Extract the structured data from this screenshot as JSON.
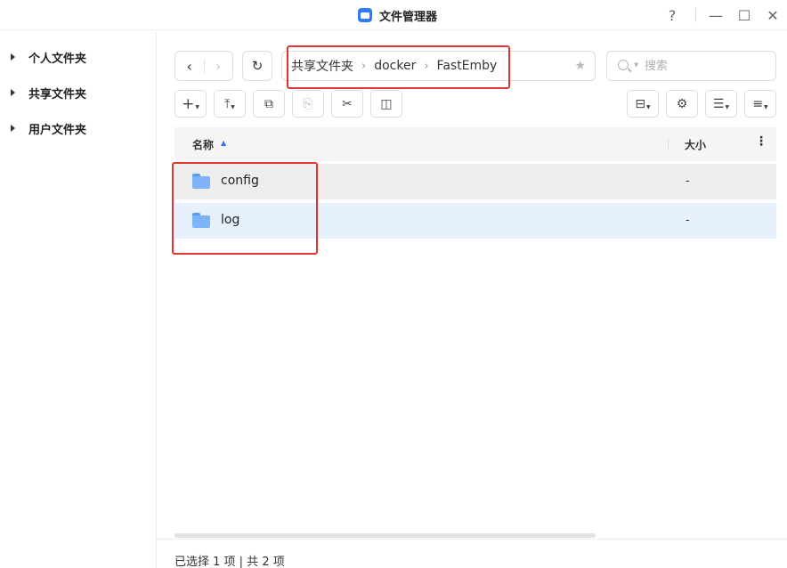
{
  "window": {
    "title": "文件管理器",
    "controls": {
      "help": "?",
      "minimize": "—",
      "maximize": "☐",
      "close": "✕"
    }
  },
  "sidebar": {
    "items": [
      {
        "label": "个人文件夹"
      },
      {
        "label": "共享文件夹"
      },
      {
        "label": "用户文件夹"
      }
    ]
  },
  "nav": {
    "back": "‹",
    "forward": "›",
    "refresh": "↻"
  },
  "breadcrumb": {
    "items": [
      "共享文件夹",
      "docker",
      "FastEmby"
    ],
    "separator": "›"
  },
  "search": {
    "placeholder": "搜索",
    "value": ""
  },
  "toolbar": {
    "new": "+",
    "upload": "⤒",
    "copy": "⧉",
    "paste": "⎘",
    "cut": "✂",
    "rename": "◫",
    "compress": "⊟",
    "settings": "⚙",
    "view": "☰",
    "sort": "≡"
  },
  "list": {
    "columns": {
      "name": "名称",
      "size": "大小",
      "more": "⋮"
    },
    "sort_indicator": "▲",
    "rows": [
      {
        "name": "config",
        "size": "-",
        "type": "folder"
      },
      {
        "name": "log",
        "size": "-",
        "type": "folder"
      }
    ]
  },
  "status": {
    "text": "已选择 1 项 | 共 2 项"
  },
  "colors": {
    "accent": "#2f7cf6",
    "selected_row": "#e7f0fd",
    "hover_row": "#ededed",
    "annotation": "#e2352d",
    "folder": "#7db4f7"
  }
}
